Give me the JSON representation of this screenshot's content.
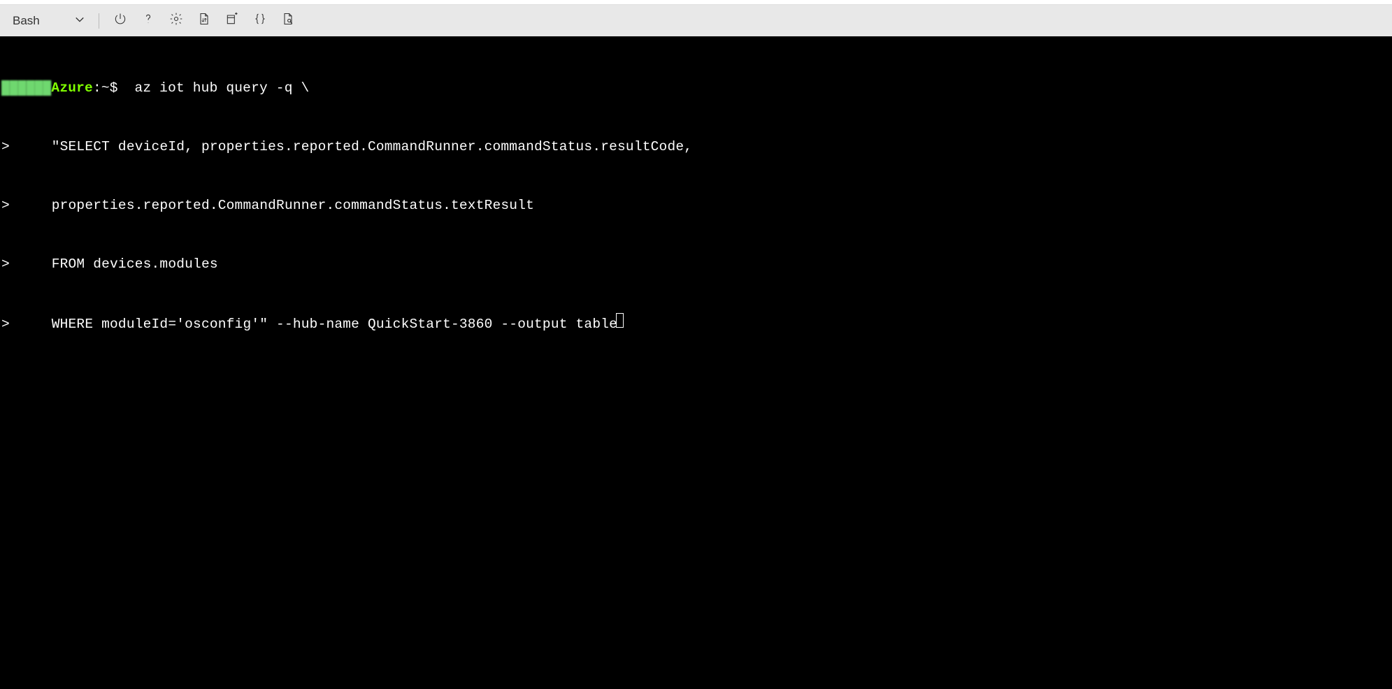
{
  "toolbar": {
    "shell_label": "Bash"
  },
  "terminal": {
    "prompt_host": "Azure",
    "prompt_path": ":~",
    "prompt_symbol": "$",
    "continuation_symbol": ">",
    "line0_cmd": "  az iot hub query -q \\",
    "line1": "   \"SELECT deviceId, properties.reported.CommandRunner.commandStatus.resultCode,",
    "line2": "   properties.reported.CommandRunner.commandStatus.textResult",
    "line3": "   FROM devices.modules",
    "line4": "   WHERE moduleId='osconfig'\" --hub-name QuickStart-3860 --output table"
  }
}
